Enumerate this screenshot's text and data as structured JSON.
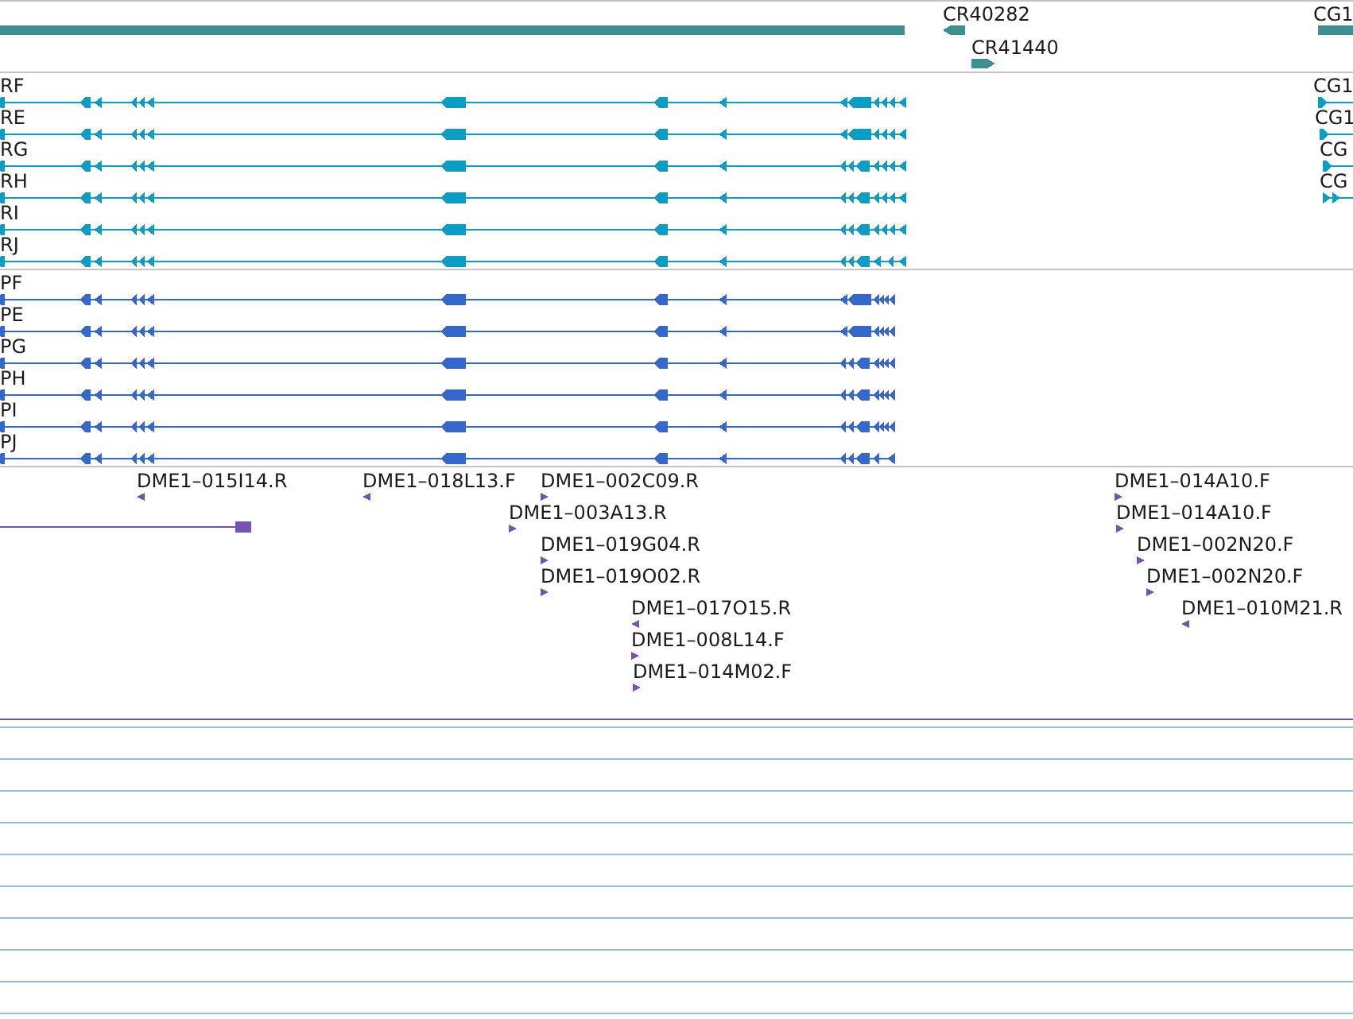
{
  "gene_track": {
    "features": [
      {
        "kind": "bar"
      },
      {
        "label": "CR40282",
        "kind": "arrow",
        "reverse": true
      },
      {
        "label": "CR41440",
        "kind": "arrow",
        "reverse": false
      },
      {
        "label": "CG1",
        "kind": "bar"
      }
    ]
  },
  "mrna_track": {
    "transcripts": [
      {
        "label": "RF",
        "reverse": true
      },
      {
        "label": "RE",
        "reverse": true
      },
      {
        "label": "RG",
        "reverse": true
      },
      {
        "label": "RH",
        "reverse": true
      },
      {
        "label": "RI",
        "reverse": true
      },
      {
        "label": "RJ",
        "reverse": true
      },
      {
        "label": "CG1",
        "reverse": false
      },
      {
        "label": "CG1",
        "reverse": false
      },
      {
        "label": "CG",
        "reverse": false
      },
      {
        "label": "CG",
        "reverse": false
      }
    ]
  },
  "protein_track": {
    "proteins": [
      {
        "label": "PF",
        "reverse": true
      },
      {
        "label": "PE",
        "reverse": true
      },
      {
        "label": "PG",
        "reverse": true
      },
      {
        "label": "PH",
        "reverse": true
      },
      {
        "label": "PI",
        "reverse": true
      },
      {
        "label": "PJ",
        "reverse": true
      }
    ]
  },
  "clone_track": {
    "clone_ends": [
      {
        "label": "DME1–015I14.R",
        "reverse": true
      },
      {
        "label": "DME1–018L13.F",
        "reverse": true
      },
      {
        "label": "DME1–002C09.R",
        "reverse": false
      },
      {
        "label": "DME1–003A13.R",
        "reverse": false
      },
      {
        "label": "DME1–019G04.R",
        "reverse": false
      },
      {
        "label": "DME1–019O02.R",
        "reverse": false
      },
      {
        "label": "DME1–017O15.R",
        "reverse": true
      },
      {
        "label": "DME1–008L14.F",
        "reverse": false
      },
      {
        "label": "DME1–014M02.F",
        "reverse": false
      },
      {
        "label": "DME1–014A10.F",
        "reverse": false
      },
      {
        "label": "DME1–014A10.F",
        "reverse": false
      },
      {
        "label": "DME1–002N20.F",
        "reverse": false
      },
      {
        "label": "DME1–002N20.F",
        "reverse": false
      },
      {
        "label": "DME1–010M21.R",
        "reverse": true
      }
    ]
  }
}
